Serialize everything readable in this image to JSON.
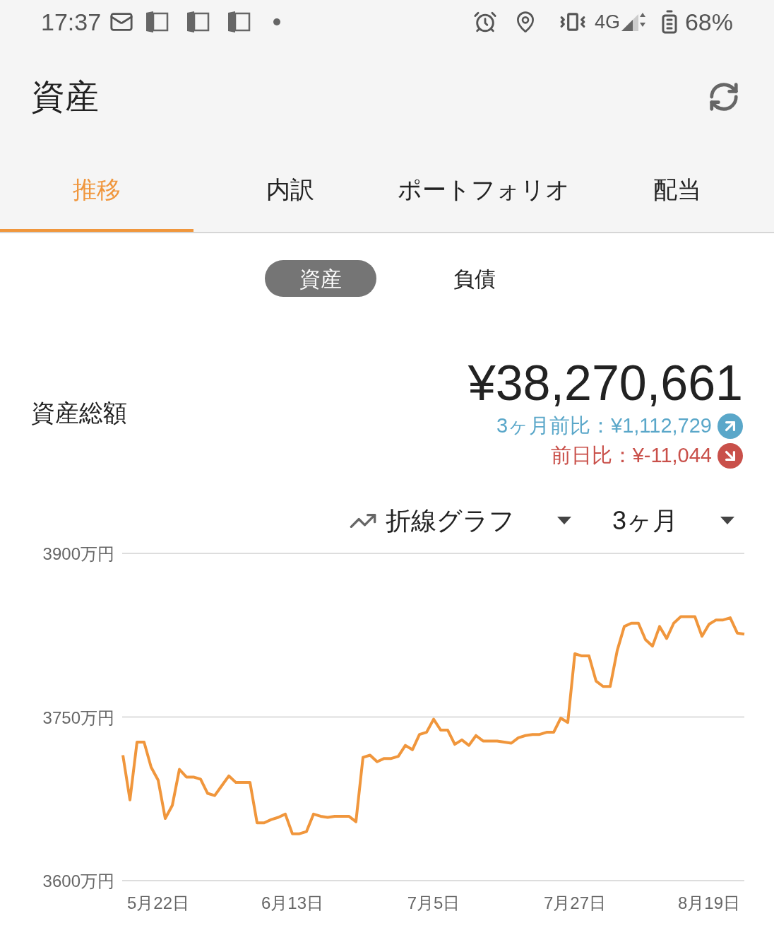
{
  "status_bar": {
    "time": "17:37",
    "network": "4G",
    "battery": "68%"
  },
  "header": {
    "title": "資産"
  },
  "tabs": [
    {
      "label": "推移",
      "selected": true
    },
    {
      "label": "内訳",
      "selected": false
    },
    {
      "label": "ポートフォリオ",
      "selected": false
    },
    {
      "label": "配当",
      "selected": false
    }
  ],
  "segments": [
    {
      "label": "資産",
      "selected": true
    },
    {
      "label": "負債",
      "selected": false
    }
  ],
  "summary": {
    "label": "資産総額",
    "total": "¥38,270,661",
    "changes": [
      {
        "kind": "up",
        "text": "3ヶ月前比：¥1,112,729"
      },
      {
        "kind": "down",
        "text": "前日比：¥-11,044"
      }
    ]
  },
  "controls": [
    {
      "kind": "chart_type",
      "label": "折線グラフ"
    },
    {
      "kind": "period",
      "label": "3ヶ月"
    }
  ],
  "chart_data": {
    "type": "line",
    "categories": [
      null,
      null,
      null,
      null,
      null,
      "5月22日",
      null,
      null,
      null,
      null,
      null,
      null,
      null,
      null,
      null,
      null,
      null,
      null,
      null,
      null,
      null,
      null,
      null,
      null,
      "6月13日",
      null,
      null,
      null,
      null,
      null,
      null,
      null,
      null,
      null,
      null,
      null,
      null,
      null,
      null,
      null,
      null,
      null,
      null,
      null,
      "7月5日",
      null,
      null,
      null,
      null,
      null,
      null,
      null,
      null,
      null,
      null,
      null,
      null,
      null,
      null,
      null,
      null,
      null,
      null,
      null,
      "7月27日",
      null,
      null,
      null,
      null,
      null,
      null,
      null,
      null,
      null,
      null,
      null,
      null,
      null,
      null,
      null,
      null,
      null,
      null,
      "8月19日",
      null,
      null,
      null,
      null,
      null
    ],
    "series": [
      {
        "color": "#f0963c",
        "values": [
          3715,
          3674,
          3727,
          3727,
          3704,
          3692,
          3657,
          3669,
          3702,
          3695,
          3695,
          3693,
          3680,
          3678,
          3687,
          3696,
          3690,
          3690,
          3690,
          3653,
          3653,
          3656,
          3658,
          3661,
          3643,
          3643,
          3645,
          3661,
          3659,
          3658,
          3659,
          3659,
          3659,
          3654,
          3713,
          3715,
          3709,
          3712,
          3712,
          3714,
          3724,
          3720,
          3734,
          3736,
          3748,
          3738,
          3738,
          3725,
          3729,
          3724,
          3733,
          3728,
          3728,
          3728,
          3727,
          3726,
          3731,
          3733,
          3734,
          3734,
          3736,
          3736,
          3749,
          3745,
          3808,
          3806,
          3806,
          3783,
          3778,
          3778,
          3811,
          3833,
          3836,
          3836,
          3821,
          3815,
          3833,
          3822,
          3836,
          3842,
          3842,
          3842,
          3824,
          3835,
          3839,
          3839,
          3841,
          3827,
          3826
        ]
      }
    ],
    "ylim": [
      3600,
      3900
    ],
    "yticks": [
      {
        "value": 3900,
        "label": "3900万円"
      },
      {
        "value": 3750,
        "label": "3750万円"
      },
      {
        "value": 3600,
        "label": "3600万円"
      }
    ]
  }
}
